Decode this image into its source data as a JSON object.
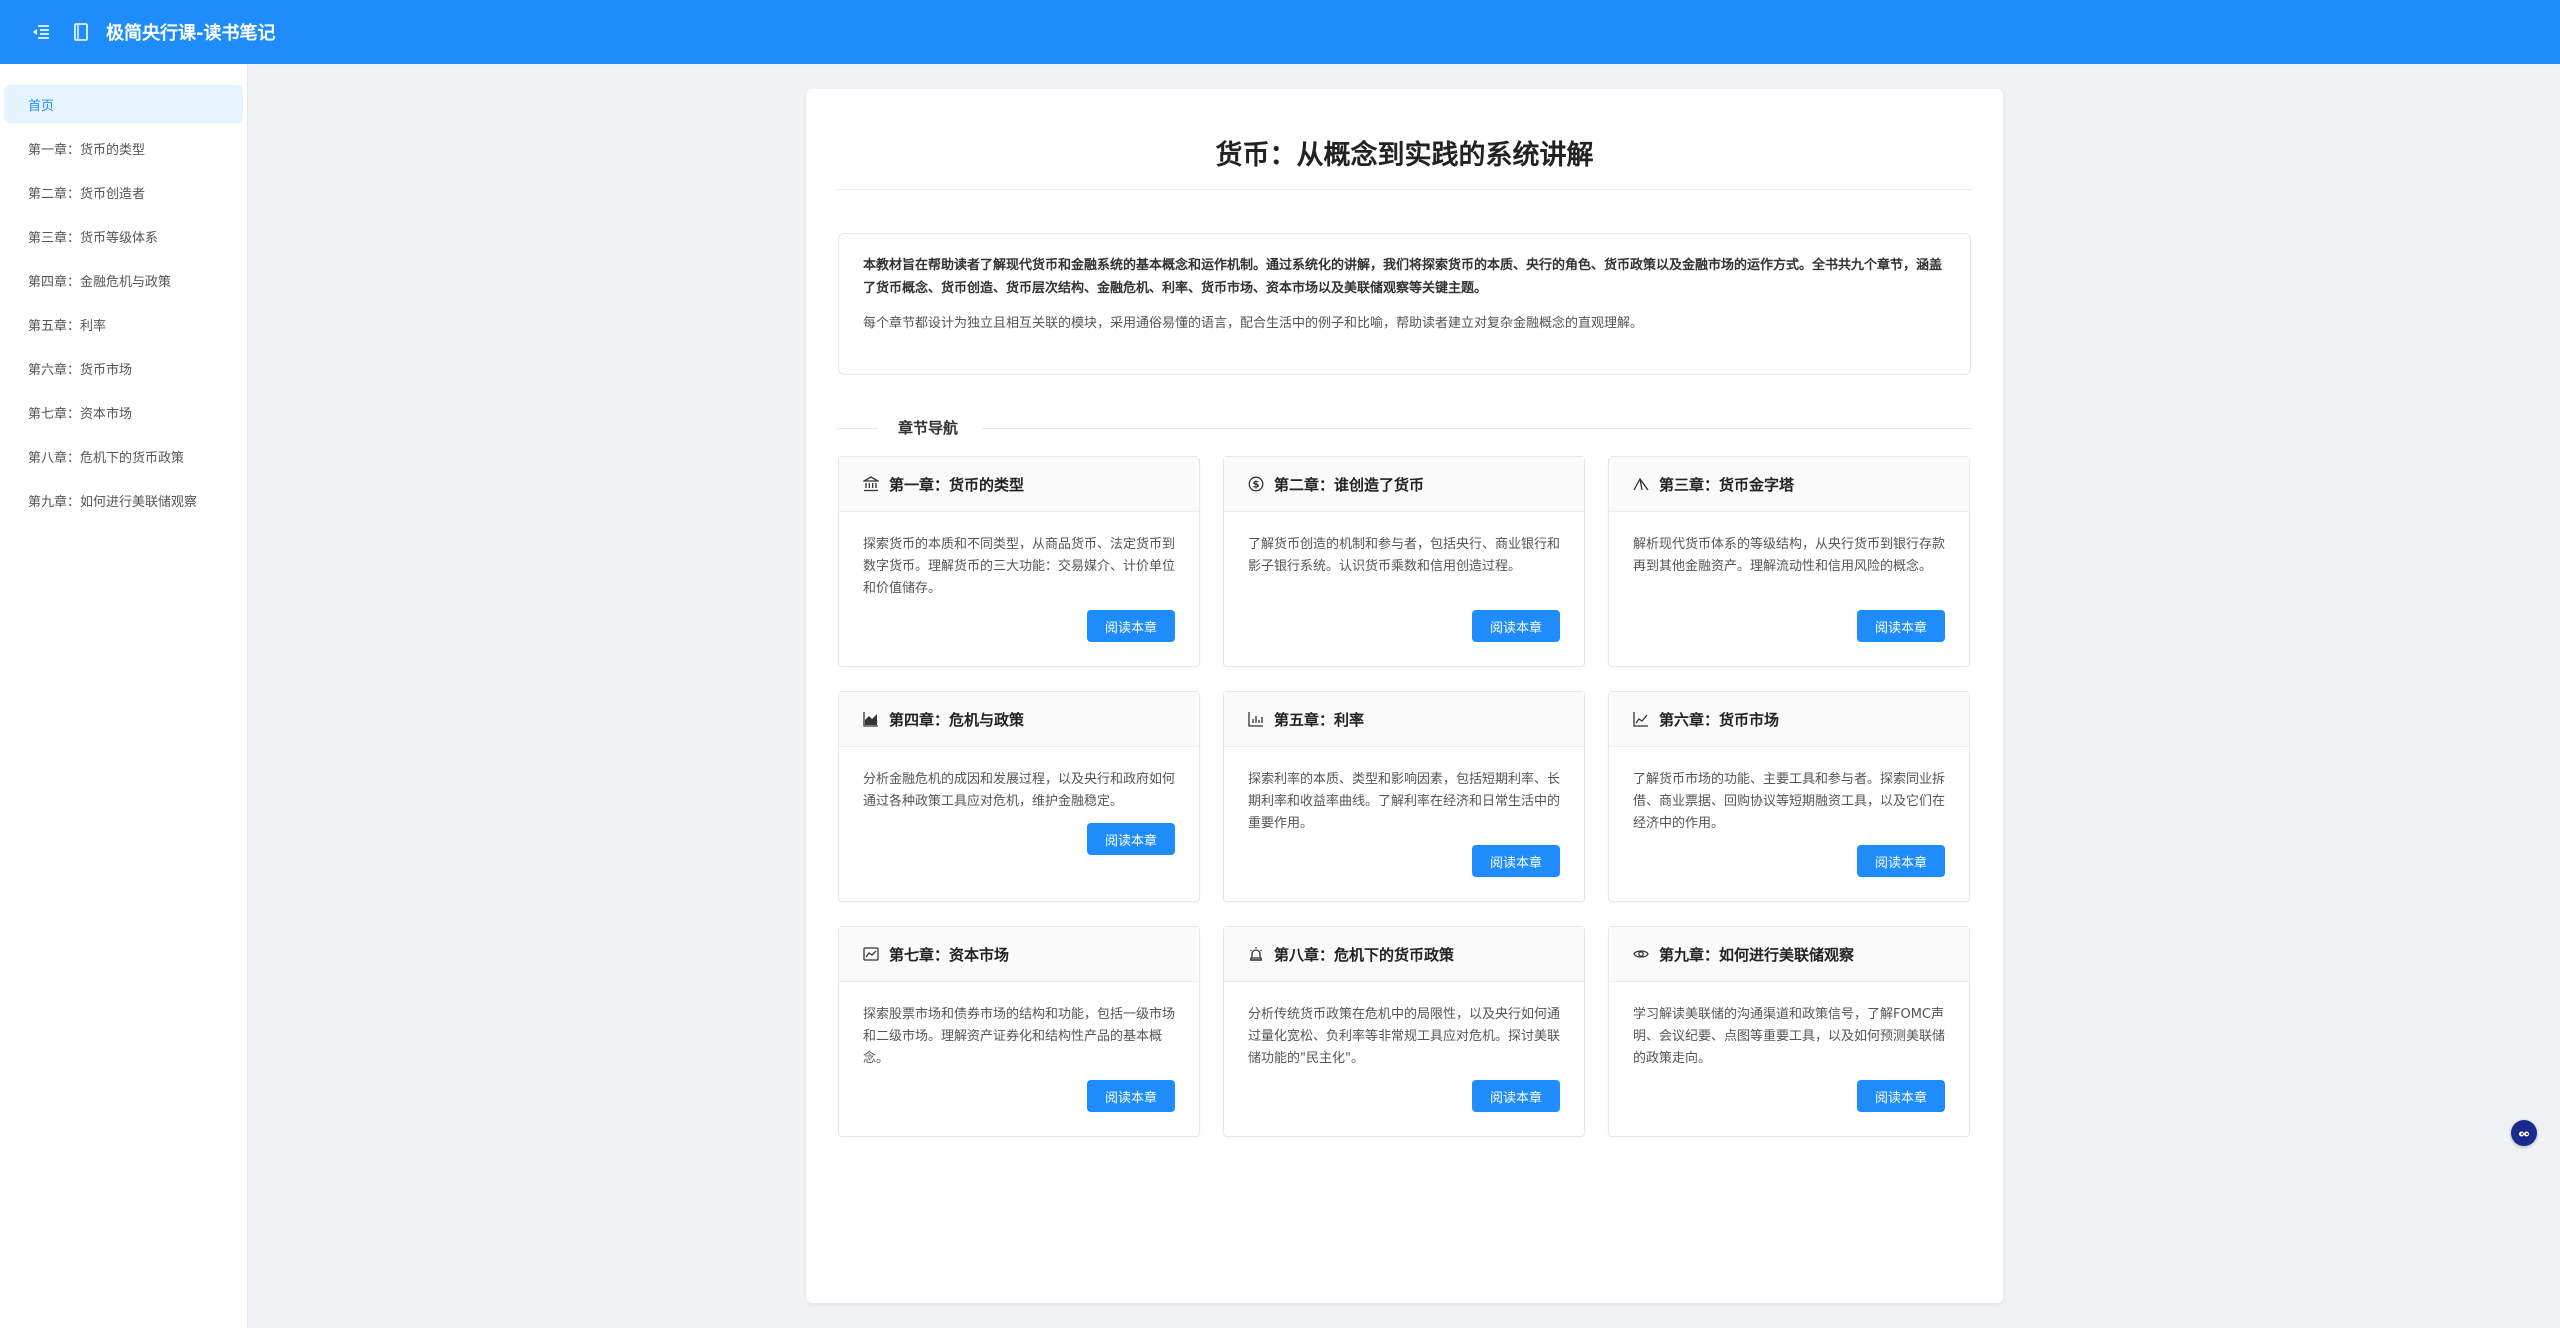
{
  "header": {
    "menu_icon": "menu-fold-icon",
    "logo_icon": "book-icon",
    "title": "极简央行课-读书笔记",
    "bg_color": "#1e8cfa"
  },
  "sidebar": {
    "items": [
      {
        "label": "首页",
        "active": true
      },
      {
        "label": "第一章：货币的类型"
      },
      {
        "label": "第二章：货币创造者"
      },
      {
        "label": "第三章：货币等级体系"
      },
      {
        "label": "第四章：金融危机与政策"
      },
      {
        "label": "第五章：利率"
      },
      {
        "label": "第六章：货币市场"
      },
      {
        "label": "第七章：资本市场"
      },
      {
        "label": "第八章：危机下的货币政策"
      },
      {
        "label": "第九章：如何进行美联储观察"
      }
    ]
  },
  "main": {
    "title": "货币：从概念到实践的系统讲解",
    "intro": {
      "p1": "本教材旨在帮助读者了解现代货币和金融系统的基本概念和运作机制。通过系统化的讲解，我们将探索货币的本质、央行的角色、货币政策以及金融市场的运作方式。全书共九个章节，涵盖了货币概念、货币创造、货币层次结构、金融危机、利率、货币市场、资本市场以及美联储观察等关键主题。",
      "p2": "每个章节都设计为独立且相互关联的模块，采用通俗易懂的语言，配合生活中的例子和比喻，帮助读者建立对复杂金融概念的直观理解。"
    },
    "section_title": "章节导航",
    "read_label": "阅读本章",
    "chapters": [
      {
        "icon": "bank-icon",
        "title": "第一章：货币的类型",
        "desc": "探索货币的本质和不同类型，从商品货币、法定货币到数字货币。理解货币的三大功能：交易媒介、计价单位和价值储存。"
      },
      {
        "icon": "dollar-circle-icon",
        "title": "第二章：谁创造了货币",
        "desc": "了解货币创造的机制和参与者，包括央行、商业银行和影子银行系统。认识货币乘数和信用创造过程。"
      },
      {
        "icon": "pyramid-icon",
        "title": "第三章：货币金字塔",
        "desc": "解析现代货币体系的等级结构，从央行货币到银行存款再到其他金融资产。理解流动性和信用风险的概念。"
      },
      {
        "icon": "area-chart-icon",
        "title": "第四章：危机与政策",
        "desc": "分析金融危机的成因和发展过程，以及央行和政府如何通过各种政策工具应对危机，维护金融稳定。"
      },
      {
        "icon": "bar-chart-icon",
        "title": "第五章：利率",
        "desc": "探索利率的本质、类型和影响因素，包括短期利率、长期利率和收益率曲线。了解利率在经济和日常生活中的重要作用。"
      },
      {
        "icon": "line-chart-icon",
        "title": "第六章：货币市场",
        "desc": "了解货币市场的功能、主要工具和参与者。探索同业拆借、商业票据、回购协议等短期融资工具，以及它们在经济中的作用。"
      },
      {
        "icon": "stock-icon",
        "title": "第七章：资本市场",
        "desc": "探索股票市场和债券市场的结构和功能，包括一级市场和二级市场。理解资产证券化和结构性产品的基本概念。"
      },
      {
        "icon": "alert-icon",
        "title": "第八章：危机下的货币政策",
        "desc": "分析传统货币政策在危机中的局限性，以及央行如何通过量化宽松、负利率等非常规工具应对危机。探讨美联储功能的\"民主化\"。"
      },
      {
        "icon": "eye-icon",
        "title": "第九章：如何进行美联储观察",
        "desc": "学习解读美联储的沟通渠道和政策信号，了解FOMC声明、会议纪要、点图等重要工具，以及如何预测美联储的政策走向。"
      }
    ]
  },
  "floating_button": {
    "icon": "chat-icon"
  }
}
